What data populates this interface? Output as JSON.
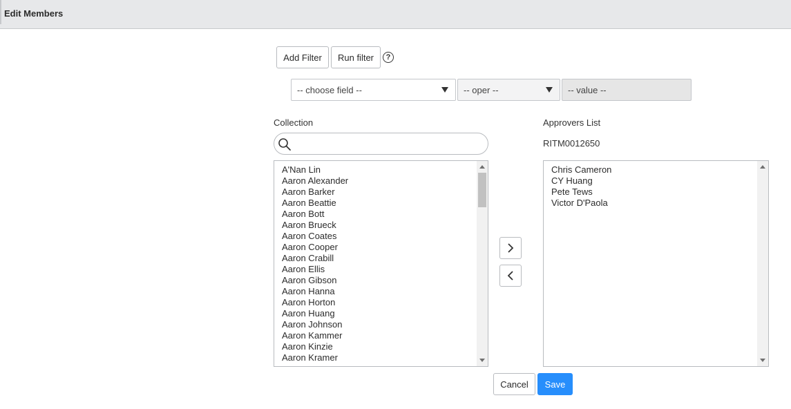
{
  "header": {
    "title": "Edit Members"
  },
  "filter": {
    "add_filter_label": "Add Filter",
    "run_filter_label": "Run filter",
    "help_glyph": "?",
    "field_placeholder": "-- choose field --",
    "oper_placeholder": "-- oper --",
    "value_placeholder": "-- value --"
  },
  "collection": {
    "label": "Collection",
    "search_placeholder": "",
    "items": [
      "A'Nan Lin",
      "Aaron Alexander",
      "Aaron Barker",
      "Aaron Beattie",
      "Aaron Bott",
      "Aaron Brueck",
      "Aaron Coates",
      "Aaron Cooper",
      "Aaron Crabill",
      "Aaron Ellis",
      "Aaron Gibson",
      "Aaron Hanna",
      "Aaron Horton",
      "Aaron Huang",
      "Aaron Johnson",
      "Aaron Kammer",
      "Aaron Kinzie",
      "Aaron Kramer"
    ]
  },
  "approvers": {
    "label": "Approvers List",
    "record": "RITM0012650",
    "items": [
      "Chris Cameron",
      "CY Huang",
      "Pete Tews",
      "Victor D'Paola"
    ]
  },
  "actions": {
    "cancel_label": "Cancel",
    "save_label": "Save"
  },
  "colors": {
    "save_accent": "#278efc",
    "header_bg": "#e7e8ea"
  },
  "icons": {
    "help": "help-circle-icon",
    "search": "search-icon",
    "add": "chevron-right-icon",
    "remove": "chevron-left-icon"
  }
}
